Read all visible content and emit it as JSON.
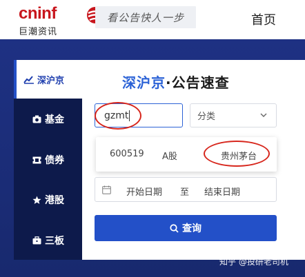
{
  "header": {
    "logo_text": "cninf",
    "logo_cn": "巨潮资讯",
    "slogan": "看公告快人一步",
    "home_link": "首页"
  },
  "colors": {
    "brand_red": "#c8161d",
    "accent_blue": "#2350c8",
    "band_blue": "#1e3183",
    "nav_dark": "#0d1a4b",
    "annotation_red": "#d7261c"
  },
  "sidenav": {
    "active": {
      "label": "深沪京",
      "icon": "chart-icon"
    },
    "items": [
      {
        "label": "基金",
        "icon": "camera-icon"
      },
      {
        "label": "债券",
        "icon": "ticket-icon"
      },
      {
        "label": "港股",
        "icon": "star-icon"
      },
      {
        "label": "三板",
        "icon": "briefcase-icon"
      }
    ]
  },
  "panel": {
    "title_highlight": "深沪京",
    "title_rest": "·公告速查",
    "search_value": "gzmt",
    "category_placeholder": "分类",
    "suggestion": {
      "code": "600519",
      "type": "A股",
      "name": "贵州茅台"
    },
    "date_start": "开始日期",
    "date_sep": "至",
    "date_end": "结束日期",
    "query_button": "查询"
  },
  "watermark": "知乎 @投研老司机"
}
